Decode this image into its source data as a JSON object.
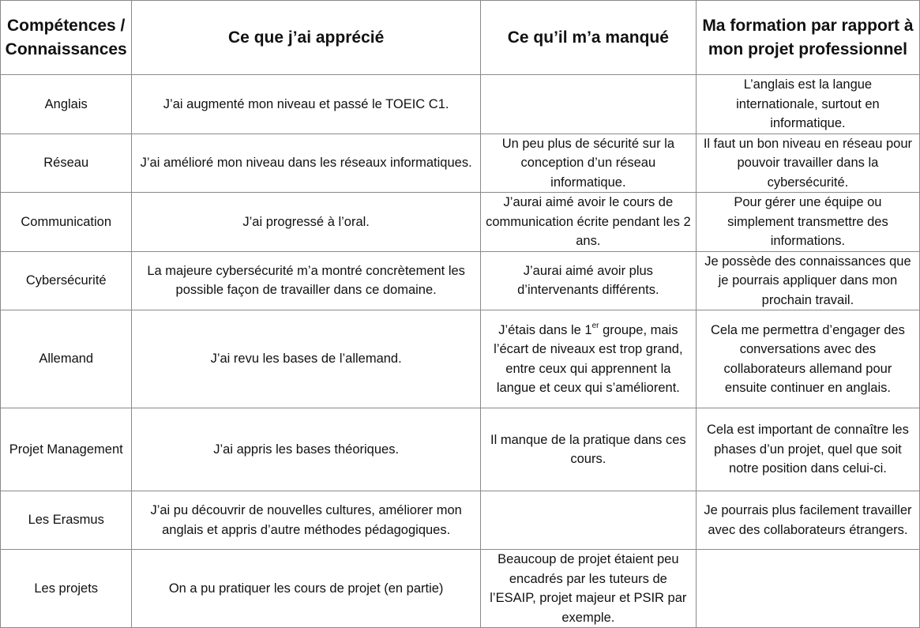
{
  "headers": {
    "col1": "Compétences / Connaissances",
    "col2": "Ce que j’ai apprécié",
    "col3": "Ce qu’il m’a manqué",
    "col4": "Ma formation par rapport à mon projet professionnel"
  },
  "rows": [
    {
      "skill": "Anglais",
      "liked": "J’ai augmenté mon niveau et passé le TOEIC C1.",
      "missing": "",
      "project": "L’anglais est la langue internationale, surtout en informatique."
    },
    {
      "skill": "Réseau",
      "liked": "J’ai amélioré mon niveau dans les réseaux informatiques.",
      "missing": "Un peu plus de sécurité sur la conception d’un réseau informatique.",
      "project": "Il faut un bon niveau en réseau pour pouvoir travailler dans la cybersécurité."
    },
    {
      "skill": "Communication",
      "liked": "J’ai progressé à l’oral.",
      "missing": "J’aurai aimé avoir le cours de communication écrite pendant les 2 ans.",
      "project": "Pour gérer une équipe ou simplement transmettre des informations."
    },
    {
      "skill": "Cybersécurité",
      "liked": "La majeure cybersécurité m’a montré concrètement les possible façon de travailler dans ce domaine.",
      "missing": "J’aurai aimé avoir plus d’intervenants différents.",
      "project": "Je possède des connaissances que je pourrais appliquer dans mon prochain travail."
    },
    {
      "skill": "Allemand",
      "liked": "J’ai revu les bases de l’allemand.",
      "missing_before": "J’étais dans le 1",
      "missing_sup": "er",
      "missing_after": " groupe, mais l’écart de niveaux est trop grand, entre ceux qui apprennent la langue et ceux qui s’améliorent.",
      "project": "Cela me permettra d’engager des conversations avec des collaborateurs allemand pour ensuite continuer en anglais."
    },
    {
      "skill": "Projet Management",
      "liked": "J’ai appris les bases théoriques.",
      "missing": "Il manque de la pratique dans ces cours.",
      "project": "Cela est important de connaître les phases d’un projet, quel que soit notre position dans celui-ci."
    },
    {
      "skill": "Les Erasmus",
      "liked": "J’ai pu découvrir de nouvelles cultures, améliorer mon anglais et appris d’autre méthodes pédagogiques.",
      "missing": "",
      "project": "Je pourrais plus facilement travailler avec des collaborateurs étrangers."
    },
    {
      "skill": "Les projets",
      "liked": "On a pu pratiquer les cours de projet (en partie)",
      "missing": "Beaucoup de projet étaient peu encadrés par les tuteurs de l’ESAIP, projet majeur et PSIR par exemple.",
      "project": ""
    }
  ]
}
